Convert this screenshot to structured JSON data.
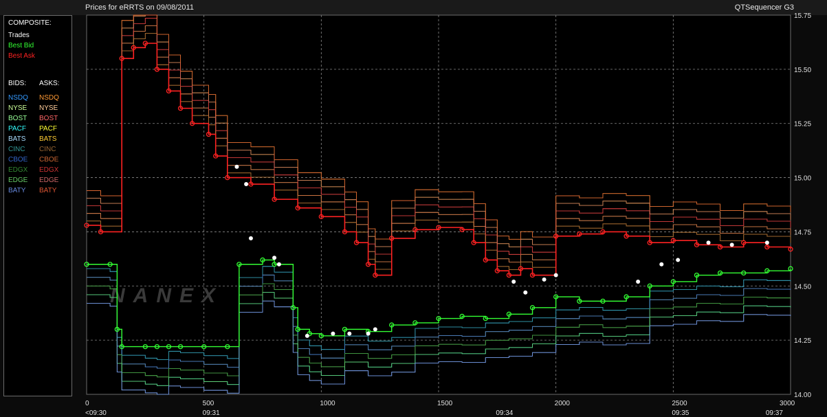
{
  "header": {
    "title": "Prices for  eRRTS  on  09/08/2011",
    "app_name": "QTSequencer G3"
  },
  "legend": {
    "composite_label": "COMPOSITE:",
    "composite": [
      {
        "name": "Trades",
        "color": "#ffffff"
      },
      {
        "name": "Best Bid",
        "color": "#33ff33"
      },
      {
        "name": "Best Ask",
        "color": "#ff2222"
      }
    ],
    "bids_label": "BIDS:",
    "asks_label": "ASKS:",
    "bids": [
      {
        "name": "NSDQ",
        "color": "#3399ff"
      },
      {
        "name": "NYSE",
        "color": "#ccff99"
      },
      {
        "name": "BOST",
        "color": "#99ff99"
      },
      {
        "name": "PACF",
        "color": "#33ffff"
      },
      {
        "name": "BATS",
        "color": "#aaddff"
      },
      {
        "name": "CINC",
        "color": "#339999"
      },
      {
        "name": "CBOE",
        "color": "#3366cc"
      },
      {
        "name": "EDGX",
        "color": "#338833"
      },
      {
        "name": "EDGE",
        "color": "#66cc66"
      },
      {
        "name": "BATY",
        "color": "#6688dd"
      }
    ],
    "asks": [
      {
        "name": "NSDQ",
        "color": "#ff9933"
      },
      {
        "name": "NYSE",
        "color": "#ffcc99"
      },
      {
        "name": "BOST",
        "color": "#ff6666"
      },
      {
        "name": "PACF",
        "color": "#ffff33"
      },
      {
        "name": "BATS",
        "color": "#ffcc33"
      },
      {
        "name": "CINC",
        "color": "#996633"
      },
      {
        "name": "CBOE",
        "color": "#cc6633"
      },
      {
        "name": "EDGX",
        "color": "#cc3333"
      },
      {
        "name": "EDGE",
        "color": "#cc6666"
      },
      {
        "name": "BATY",
        "color": "#dd5533"
      }
    ]
  },
  "watermark": "NANEX",
  "chart_data": {
    "type": "line",
    "title": "Prices for  eRRTS  on  09/08/2011",
    "xlim": [
      0,
      3000
    ],
    "ylim": [
      14.0,
      15.75
    ],
    "x_ticks": [
      0,
      500,
      1000,
      1500,
      2000,
      2500,
      3000
    ],
    "y_ticks": [
      14.0,
      14.25,
      14.5,
      14.75,
      15.0,
      15.25,
      15.5,
      15.75
    ],
    "y_tick_labels": [
      "14.00",
      "14.25",
      "14.50",
      "14.75",
      "15.00",
      "15.25",
      "15.50",
      "15.75"
    ],
    "time_labels": [
      {
        "x": 0,
        "label": "<09:30"
      },
      {
        "x": 500,
        "label": "09:31"
      },
      {
        "x": 1750,
        "label": "09:34"
      },
      {
        "x": 2500,
        "label": "09:35"
      },
      {
        "x": 2900,
        "label": "09:37"
      }
    ],
    "grid": true,
    "series": [
      {
        "name": "Best Ask",
        "color": "#ff2222",
        "points": [
          [
            0,
            14.78
          ],
          [
            60,
            14.75
          ],
          [
            150,
            15.55
          ],
          [
            200,
            15.6
          ],
          [
            250,
            15.62
          ],
          [
            300,
            15.5
          ],
          [
            350,
            15.4
          ],
          [
            400,
            15.32
          ],
          [
            450,
            15.25
          ],
          [
            520,
            15.2
          ],
          [
            550,
            15.1
          ],
          [
            600,
            15.0
          ],
          [
            700,
            14.97
          ],
          [
            800,
            14.9
          ],
          [
            900,
            14.86
          ],
          [
            1000,
            14.82
          ],
          [
            1100,
            14.75
          ],
          [
            1150,
            14.7
          ],
          [
            1200,
            14.6
          ],
          [
            1230,
            14.55
          ],
          [
            1300,
            14.72
          ],
          [
            1400,
            14.76
          ],
          [
            1500,
            14.77
          ],
          [
            1600,
            14.76
          ],
          [
            1650,
            14.7
          ],
          [
            1700,
            14.62
          ],
          [
            1750,
            14.57
          ],
          [
            1800,
            14.55
          ],
          [
            1850,
            14.58
          ],
          [
            1900,
            14.55
          ],
          [
            2000,
            14.73
          ],
          [
            2100,
            14.74
          ],
          [
            2200,
            14.75
          ],
          [
            2300,
            14.73
          ],
          [
            2400,
            14.7
          ],
          [
            2500,
            14.71
          ],
          [
            2600,
            14.69
          ],
          [
            2700,
            14.68
          ],
          [
            2800,
            14.7
          ],
          [
            2900,
            14.68
          ],
          [
            3000,
            14.67
          ]
        ]
      },
      {
        "name": "Best Bid",
        "color": "#33ff33",
        "points": [
          [
            0,
            14.6
          ],
          [
            100,
            14.6
          ],
          [
            130,
            14.3
          ],
          [
            150,
            14.22
          ],
          [
            250,
            14.22
          ],
          [
            300,
            14.22
          ],
          [
            350,
            14.22
          ],
          [
            400,
            14.22
          ],
          [
            500,
            14.22
          ],
          [
            600,
            14.22
          ],
          [
            650,
            14.6
          ],
          [
            750,
            14.62
          ],
          [
            800,
            14.6
          ],
          [
            880,
            14.4
          ],
          [
            900,
            14.3
          ],
          [
            950,
            14.28
          ],
          [
            1000,
            14.27
          ],
          [
            1100,
            14.3
          ],
          [
            1200,
            14.29
          ],
          [
            1300,
            14.32
          ],
          [
            1400,
            14.33
          ],
          [
            1500,
            14.35
          ],
          [
            1600,
            14.36
          ],
          [
            1700,
            14.35
          ],
          [
            1800,
            14.37
          ],
          [
            1900,
            14.4
          ],
          [
            2000,
            14.45
          ],
          [
            2100,
            14.43
          ],
          [
            2200,
            14.43
          ],
          [
            2300,
            14.45
          ],
          [
            2400,
            14.5
          ],
          [
            2500,
            14.52
          ],
          [
            2600,
            14.55
          ],
          [
            2700,
            14.56
          ],
          [
            2800,
            14.56
          ],
          [
            2900,
            14.57
          ],
          [
            3000,
            14.58
          ]
        ]
      },
      {
        "name": "Trades",
        "color": "#ffffff",
        "points": [
          [
            640,
            15.05
          ],
          [
            680,
            14.97
          ],
          [
            700,
            14.72
          ],
          [
            800,
            14.63
          ],
          [
            820,
            14.6
          ],
          [
            940,
            14.27
          ],
          [
            1050,
            14.28
          ],
          [
            1120,
            14.28
          ],
          [
            1200,
            14.28
          ],
          [
            1230,
            14.3
          ],
          [
            1820,
            14.52
          ],
          [
            1870,
            14.47
          ],
          [
            1950,
            14.53
          ],
          [
            2000,
            14.55
          ],
          [
            2350,
            14.52
          ],
          [
            2450,
            14.6
          ],
          [
            2520,
            14.62
          ],
          [
            2650,
            14.7
          ],
          [
            2750,
            14.69
          ],
          [
            2900,
            14.7
          ]
        ]
      }
    ]
  }
}
